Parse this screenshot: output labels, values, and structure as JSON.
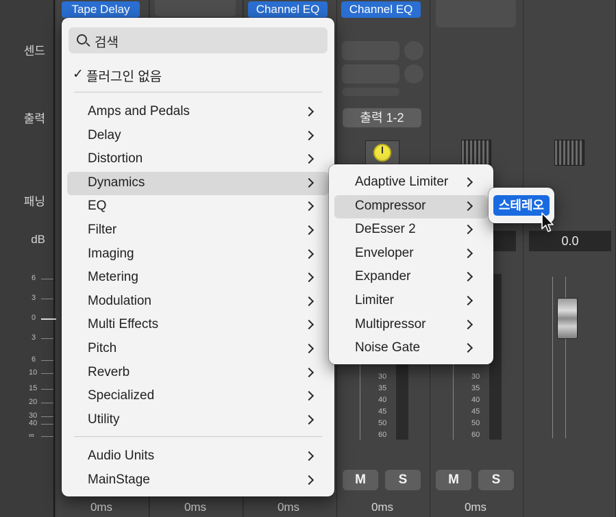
{
  "row_labels": {
    "sends": "센드",
    "output": "출력",
    "pan": "패닝",
    "db": "dB"
  },
  "channels": {
    "ch1_plugin": "Tape Delay",
    "ch3_plugin": "Channel EQ",
    "ch4_plugin": "Channel EQ",
    "ch4_output": "출력 1-2",
    "db_value": "0.0",
    "mute_label": "M",
    "solo_label": "S",
    "delay_values": [
      "0ms",
      "0ms",
      "0ms",
      "0ms",
      "0ms"
    ]
  },
  "fader_scale": [
    "6",
    "3",
    "0",
    "3",
    "6",
    "10",
    "15",
    "20",
    "30",
    "40",
    "∞"
  ],
  "meter_scale": [
    "30",
    "35",
    "40",
    "45",
    "50",
    "60"
  ],
  "menu": {
    "search_placeholder": "검색",
    "no_plugin": "플러그인 없음",
    "categories": [
      {
        "label": "Amps and Pedals",
        "highlighted": false
      },
      {
        "label": "Delay",
        "highlighted": false
      },
      {
        "label": "Distortion",
        "highlighted": false
      },
      {
        "label": "Dynamics",
        "highlighted": true
      },
      {
        "label": "EQ",
        "highlighted": false
      },
      {
        "label": "Filter",
        "highlighted": false
      },
      {
        "label": "Imaging",
        "highlighted": false
      },
      {
        "label": "Metering",
        "highlighted": false
      },
      {
        "label": "Modulation",
        "highlighted": false
      },
      {
        "label": "Multi Effects",
        "highlighted": false
      },
      {
        "label": "Pitch",
        "highlighted": false
      },
      {
        "label": "Reverb",
        "highlighted": false
      },
      {
        "label": "Specialized",
        "highlighted": false
      },
      {
        "label": "Utility",
        "highlighted": false
      }
    ],
    "formats": [
      {
        "label": "Audio Units"
      },
      {
        "label": "MainStage"
      }
    ]
  },
  "submenu": {
    "items": [
      {
        "label": "Adaptive Limiter",
        "highlighted": false
      },
      {
        "label": "Compressor",
        "highlighted": true
      },
      {
        "label": "DeEsser 2",
        "highlighted": false
      },
      {
        "label": "Enveloper",
        "highlighted": false
      },
      {
        "label": "Expander",
        "highlighted": false
      },
      {
        "label": "Limiter",
        "highlighted": false
      },
      {
        "label": "Multipressor",
        "highlighted": false
      },
      {
        "label": "Noise Gate",
        "highlighted": false
      }
    ]
  },
  "tertiary": {
    "stereo_label": "스테레오"
  },
  "colors": {
    "accent": "#1a6be0",
    "plugin_slot": "#2a6fd1",
    "menu_bg": "#f3f3f3",
    "highlight": "#d9d9d9",
    "pan_knob": "#f2e640"
  }
}
